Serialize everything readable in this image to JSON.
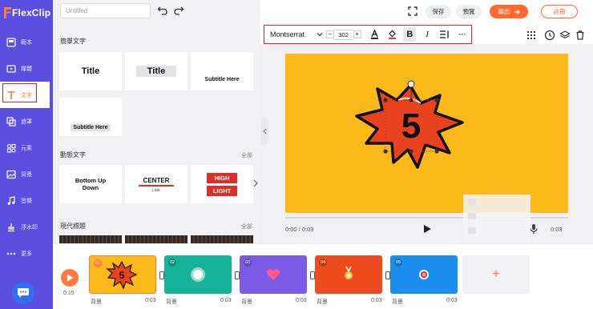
{
  "app": {
    "name": "FlexClip"
  },
  "sidebar": {
    "items": [
      {
        "label": "範本",
        "icon": "template-icon"
      },
      {
        "label": "媒體",
        "icon": "media-icon"
      },
      {
        "label": "文字",
        "icon": "text-icon",
        "active": true
      },
      {
        "label": "遮罩",
        "icon": "overlay-icon"
      },
      {
        "label": "元素",
        "icon": "elements-icon"
      },
      {
        "label": "背景",
        "icon": "background-icon"
      },
      {
        "label": "音樂",
        "icon": "music-icon"
      },
      {
        "label": "浮水印",
        "icon": "watermark-icon"
      },
      {
        "label": "更多",
        "icon": "more-icon"
      }
    ]
  },
  "header": {
    "project_placeholder": "Untitled",
    "save_label": "保存",
    "preview_label": "預覽",
    "export_label": "輸出",
    "register_label": "註冊"
  },
  "panel": {
    "simple_text": {
      "title": "簡單文字",
      "cards": [
        "Title",
        "Title",
        "Subtitle Here",
        "Subtitle Here"
      ]
    },
    "animated_text": {
      "title": "動態文字",
      "more": "全部",
      "cards": [
        {
          "line1": "Bottom Up",
          "line2": "Down"
        },
        {
          "line1": "CENTER",
          "line2": "LINE"
        },
        {
          "line1": "HIGH",
          "line2": "LIGHT"
        }
      ]
    },
    "modern_title": {
      "title": "現代標題",
      "more": "全部"
    }
  },
  "toolbar": {
    "font": "Montserrat",
    "minus": "−",
    "size": "302",
    "plus": "+",
    "bold": "B",
    "italic": "I",
    "more": "···"
  },
  "canvas": {
    "number": "5",
    "background_color": "#fbb91a",
    "burst_color": "#e8421f"
  },
  "player": {
    "current_time": "0:00 / 0:03",
    "end_time": "0:03"
  },
  "timeline": {
    "total": "0:15",
    "add_label": "+",
    "scenes": [
      {
        "num": "01",
        "label": "背景",
        "duration": "0:03",
        "color": "#fbb91a"
      },
      {
        "num": "02",
        "label": "背景",
        "duration": "0:03",
        "color": "#14b39a"
      },
      {
        "num": "03",
        "label": "背景",
        "duration": "0:03",
        "color": "#7b5be6"
      },
      {
        "num": "04",
        "label": "背景",
        "duration": "0:03",
        "color": "#ee4b1e"
      },
      {
        "num": "05",
        "label": "背景",
        "duration": "0:03",
        "color": "#1a8ff0"
      }
    ]
  },
  "colors": {
    "brand_purple": "#5b4fe0",
    "accent_orange": "#ff6a2e",
    "highlight_red": "#e5202e"
  }
}
